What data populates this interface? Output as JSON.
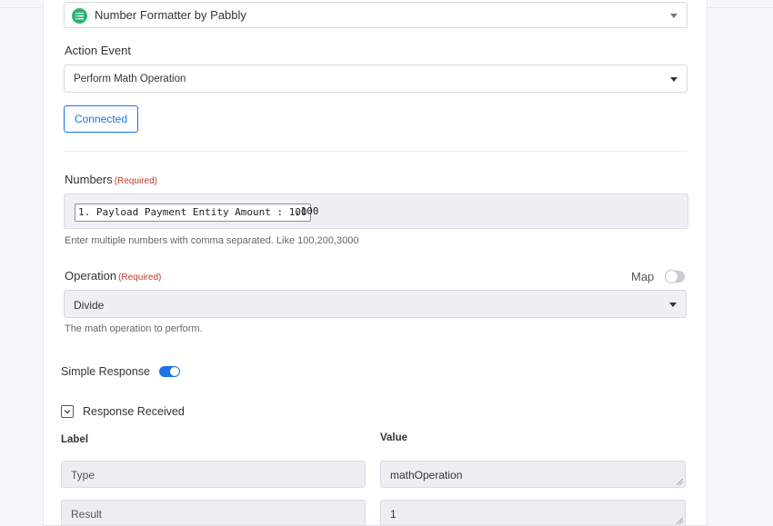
{
  "app": {
    "selected_app": "Number Formatter by Pabbly"
  },
  "action_event": {
    "label": "Action Event",
    "value": "Perform Math Operation"
  },
  "connected_button": "Connected",
  "numbers": {
    "label": "Numbers",
    "required": "(Required)",
    "token": "1. Payload Payment Entity Amount : 100",
    "suffix": ",100",
    "help": "Enter multiple numbers with comma separated. Like 100,200,3000"
  },
  "operation": {
    "label": "Operation",
    "required": "(Required)",
    "map_label": "Map",
    "map_enabled": false,
    "value": "Divide",
    "help": "The math operation to perform."
  },
  "simple_response": {
    "label": "Simple Response",
    "enabled": true
  },
  "response": {
    "label": "Response Received",
    "col_label": "Label",
    "col_value": "Value",
    "rows": [
      {
        "label": "Type",
        "value": "mathOperation"
      },
      {
        "label": "Result",
        "value": "1"
      }
    ]
  },
  "colors": {
    "accent": "#1a73e8",
    "app_icon": "#2bb673",
    "required": "#c0392b"
  }
}
